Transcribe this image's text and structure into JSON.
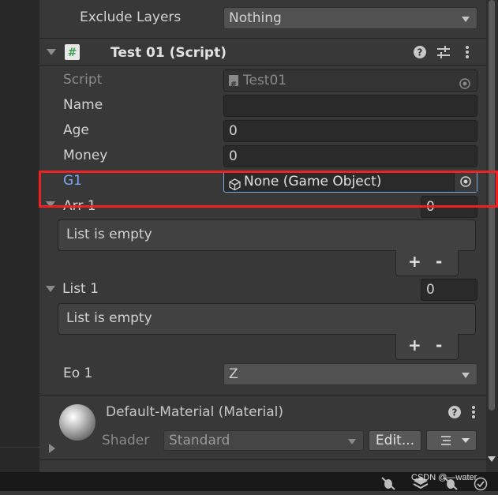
{
  "top_fields": {
    "exclude_layers_label": "Exclude Layers",
    "exclude_layers_value": "Nothing"
  },
  "component": {
    "title": "Test 01 (Script)",
    "script_label": "Script",
    "script_value": "Test01",
    "name_label": "Name",
    "name_value": "",
    "age_label": "Age",
    "age_value": "0",
    "money_label": "Money",
    "money_value": "0",
    "g1_label": "G1",
    "g1_value": "None (Game Object)",
    "arr1_label": "Arr 1",
    "arr1_size": "0",
    "arr1_empty": "List is empty",
    "list1_label": "List 1",
    "list1_size": "0",
    "list1_empty": "List is empty",
    "add_label": "+",
    "remove_label": "-",
    "eo1_label": "Eo 1",
    "eo1_value": "Z"
  },
  "material": {
    "title": "Default-Material (Material)",
    "shader_label": "Shader",
    "shader_value": "Standard",
    "edit_label": "Edit..."
  },
  "watermark": "CSDN @—water",
  "icons": {
    "script": "script-hash-icon",
    "help": "help-icon",
    "presets": "presets-icon",
    "menu": "kebab-menu-icon",
    "object_picker": "object-picker-icon",
    "gameobject": "cube-icon"
  },
  "colors": {
    "highlight": "#ee2222",
    "g1_label": "#7ea6f0",
    "script_icon": "#3da34f"
  }
}
